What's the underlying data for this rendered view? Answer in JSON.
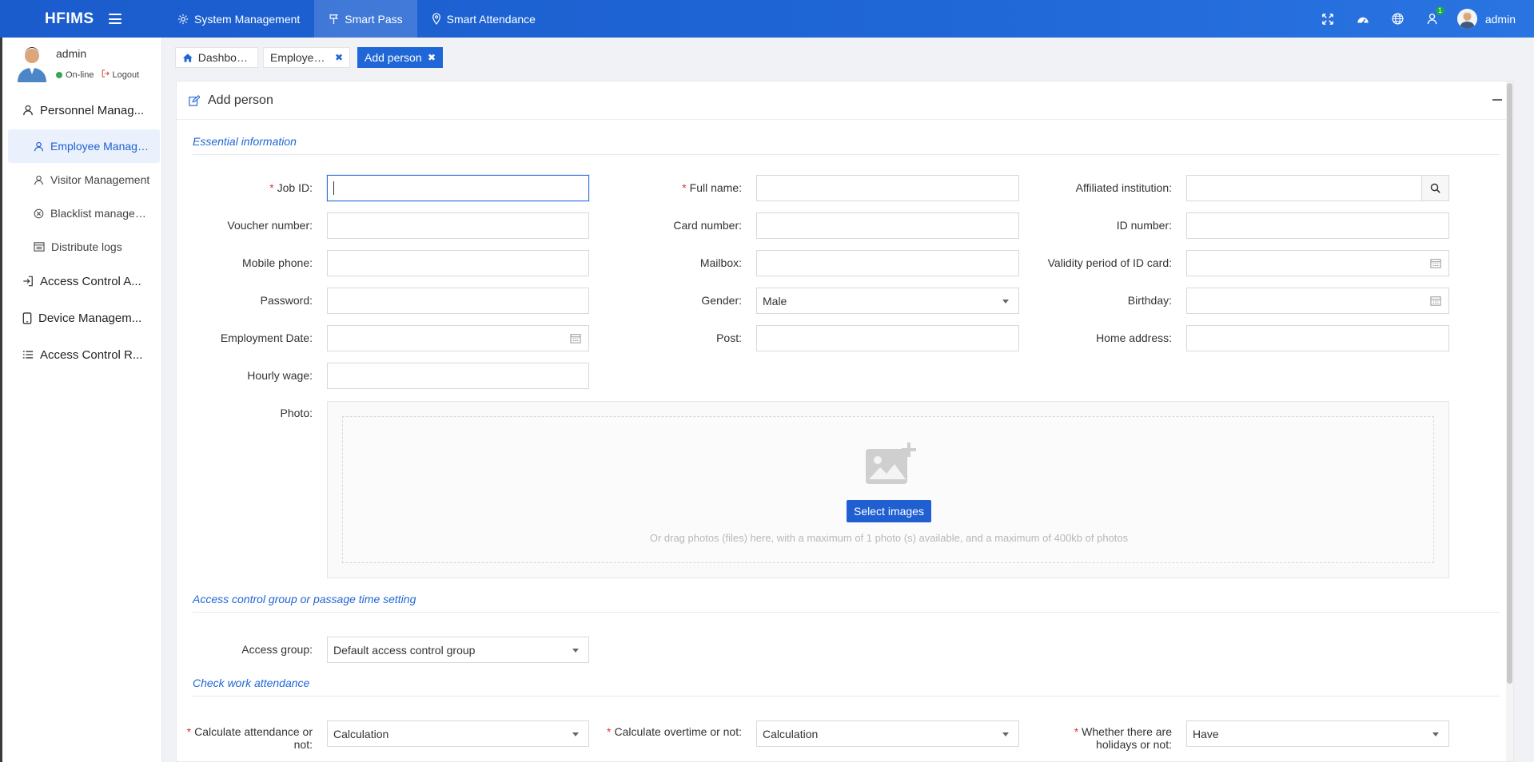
{
  "topbar": {
    "brand": "HFIMS",
    "nav": [
      {
        "label": "System Management",
        "icon": "gear-icon"
      },
      {
        "label": "Smart Pass",
        "icon": "signpost-icon"
      },
      {
        "label": "Smart Attendance",
        "icon": "location-pin-icon"
      }
    ],
    "notification_count": "1",
    "user": "admin"
  },
  "sidebar": {
    "user": {
      "name": "admin",
      "status": "On-line",
      "logout": "Logout"
    },
    "groups": [
      {
        "label": "Personnel Manag...",
        "icon": "user-icon"
      },
      {
        "label": "Access Control A...",
        "icon": "sign-in-icon"
      },
      {
        "label": "Device Managem...",
        "icon": "tablet-icon"
      },
      {
        "label": "Access Control R...",
        "icon": "list-icon"
      }
    ],
    "items": [
      {
        "label": "Employee Manage...",
        "icon": "user-icon"
      },
      {
        "label": "Visitor Management",
        "icon": "user-icon"
      },
      {
        "label": "Blacklist managem...",
        "icon": "ban-icon"
      },
      {
        "label": "Distribute logs",
        "icon": "log-icon"
      }
    ]
  },
  "tabs": [
    {
      "label": "Dashboa..."
    },
    {
      "label": "Employee ..."
    },
    {
      "label": "Add person"
    }
  ],
  "card": {
    "title": "Add person"
  },
  "sections": {
    "essential": "Essential information",
    "access": "Access control group or passage time setting",
    "attendance": "Check work attendance"
  },
  "form": {
    "job_id": {
      "label": "Job ID:",
      "value": ""
    },
    "full_name": {
      "label": "Full name:",
      "value": ""
    },
    "affiliated": {
      "label": "Affiliated institution:",
      "value": ""
    },
    "voucher": {
      "label": "Voucher number:",
      "value": ""
    },
    "card_number": {
      "label": "Card number:",
      "value": ""
    },
    "id_number": {
      "label": "ID number:",
      "value": ""
    },
    "mobile": {
      "label": "Mobile phone:",
      "value": ""
    },
    "mailbox": {
      "label": "Mailbox:",
      "value": ""
    },
    "validity": {
      "label": "Validity period of ID card:",
      "value": ""
    },
    "password": {
      "label": "Password:",
      "value": ""
    },
    "gender": {
      "label": "Gender:",
      "value": "Male"
    },
    "birthday": {
      "label": "Birthday:",
      "value": ""
    },
    "employment": {
      "label": "Employment Date:",
      "value": ""
    },
    "post": {
      "label": "Post:",
      "value": ""
    },
    "home": {
      "label": "Home address:",
      "value": ""
    },
    "hourly": {
      "label": "Hourly wage:",
      "value": ""
    },
    "photo": {
      "label": "Photo:",
      "button": "Select images",
      "hint": "Or drag photos (files) here, with a maximum of 1 photo (s) available, and a maximum of 400kb of photos"
    },
    "access_group": {
      "label": "Access group:",
      "value": "Default access control group"
    },
    "calc_attendance": {
      "label": "Calculate attendance or not:",
      "value": "Calculation"
    },
    "calc_overtime": {
      "label": "Calculate overtime or not:",
      "value": "Calculation"
    },
    "holidays": {
      "label": "Whether there are holidays or not:",
      "value": "Have"
    }
  },
  "colors": {
    "primary": "#1f66d6",
    "required": "#e0322f",
    "online": "#3aa655"
  }
}
